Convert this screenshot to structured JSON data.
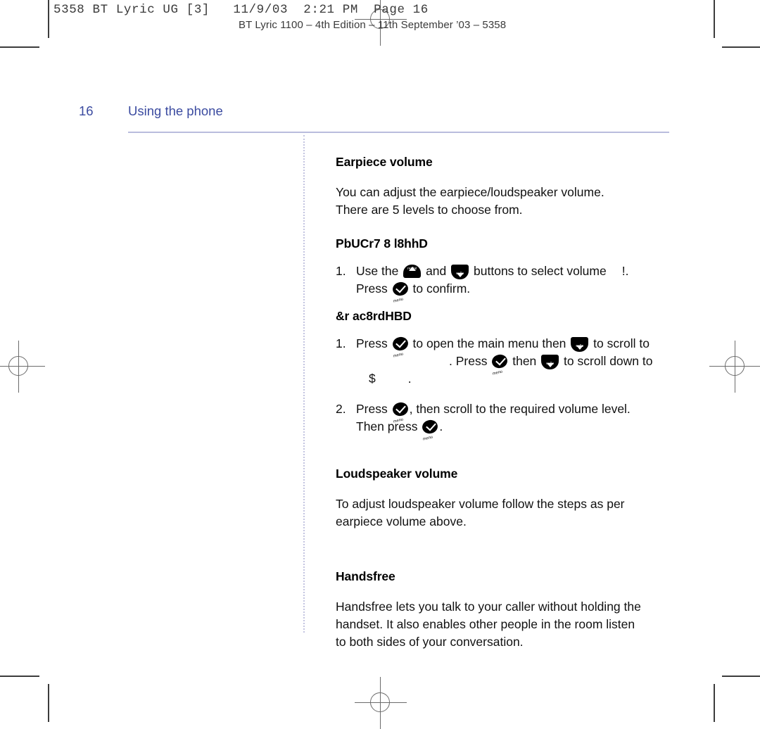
{
  "print_marks": {
    "slug_mono": "5358 BT Lyric UG [3]   11/9/03  2:21 PM  Page 16",
    "slug_title": "BT Lyric 1100 – 4th Edition – 11th September ’03 – 5358",
    "registration_icon": "registration-target",
    "crop_icon": "crop-mark"
  },
  "page": {
    "folio": "16",
    "running_head": "Using the phone",
    "rule_color": "#b9bcdd",
    "heading_color": "#3b4ba0"
  },
  "icons": {
    "redial_label": "redial",
    "calls_label": "calls",
    "menu_label": "menu"
  },
  "sections": [
    {
      "id": "earpiece-volume",
      "heading": "Earpiece volume",
      "paragraphs": [
        "You can adjust the earpiece/loudspeaker volume.",
        "There are 5 levels to choose from."
      ]
    },
    {
      "id": "handset-subsection",
      "heading": "PbUCr7 8 l8hhD",
      "steps": [
        {
          "num": "1.",
          "line1_a": "Use the",
          "line1_b": "and",
          "line1_c": "buttons to select volume",
          "line1_d": "!",
          "line1_e": ".",
          "line2_a": "Press",
          "line2_b": "to confirm."
        }
      ]
    },
    {
      "id": "menu-subsection",
      "heading": "&r ac8rdHBD",
      "steps": [
        {
          "num": "1.",
          "l1_a": "Press",
          "l1_b": "to open the main menu then",
          "l1_c": "to scroll to",
          "l2_a": ".",
          "l2_b": "Press",
          "l2_c": "then",
          "l2_d": "to scroll down to",
          "l3_a": "$",
          "l3_b": "."
        },
        {
          "num": "2.",
          "l1_a": "Press",
          "l1_b": ", then scroll to the required volume level.",
          "l2_a": "Then press",
          "l2_b": "."
        }
      ]
    },
    {
      "id": "loudspeaker-volume",
      "heading": "Loudspeaker volume",
      "paragraphs": [
        "To adjust loudspeaker volume follow the steps as per",
        "earpiece volume above."
      ]
    },
    {
      "id": "handsfree",
      "heading": "Handsfree",
      "paragraphs": [
        "Handsfree lets you talk to your caller without holding the",
        "handset. It also enables other people in the room listen",
        "to both sides of your conversation."
      ]
    }
  ]
}
